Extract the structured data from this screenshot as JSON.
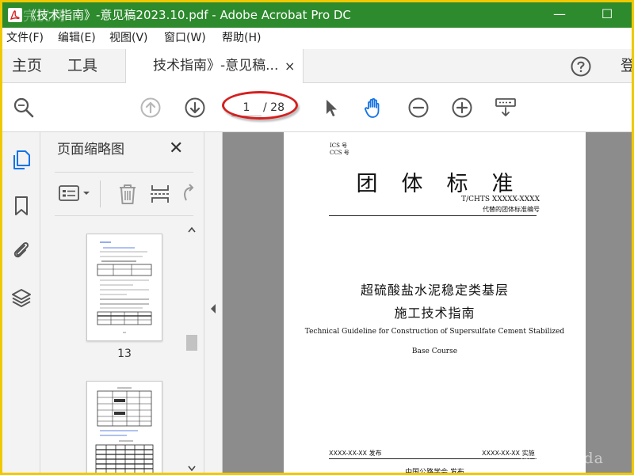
{
  "window": {
    "title": "《技术指南》-意见稿2023.10.pdf - Adobe Acrobat Pro DC",
    "watermark_top": "完优网",
    "minimize_symbol": "—",
    "maximize_symbol": "☐"
  },
  "menu": [
    "文件(F)",
    "编辑(E)",
    "视图(V)",
    "窗口(W)",
    "帮助(H)"
  ],
  "tabs": {
    "home": "主页",
    "tools": "工具",
    "document": "技术指南》-意见稿...",
    "close": "×",
    "sign_in": "登"
  },
  "toolbar": {
    "current_page": "1",
    "total_pages": "/ 28",
    "icons": [
      "search-zoom",
      "page-up",
      "page-down",
      "select-arrow",
      "hand-pan",
      "zoom-out",
      "zoom-in",
      "keyboard-tools"
    ]
  },
  "panel": {
    "title": "页面缩略图",
    "close": "✕",
    "thumbnails": [
      {
        "label": "13"
      },
      {
        "label": ""
      }
    ]
  },
  "document": {
    "ics": "ICS 号",
    "ccs": "CCS 号",
    "heading": "团体标准",
    "standard_no": "T/CHTS XXXXX-XXXX",
    "replaces": "代替的团体标准编号",
    "cn_title_line1": "超硫酸盐水泥稳定类基层",
    "cn_title_line2": "施工技术指南",
    "en_title_line1": "Technical Guideline for Construction of Supersulfate Cement Stabilized",
    "en_title_line2": "Base Course",
    "release_date": "XXXX-XX-XX 发布",
    "effective_date": "XXXX-XX-XX 实施",
    "publisher": "中国公路学会 发布"
  },
  "watermark_bottom": "www.cnda",
  "colors": {
    "titlebar": "#2d8a2d",
    "outer_border": "#f0c800",
    "highlight": "#d42020",
    "accent_blue": "#1473e6",
    "doc_bg": "#8c8c8c"
  }
}
